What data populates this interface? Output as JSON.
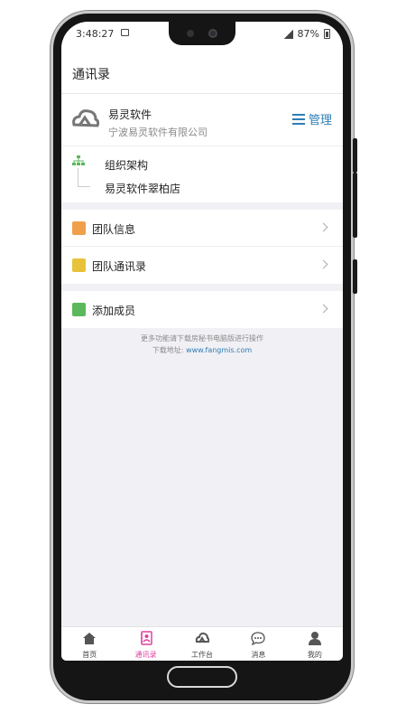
{
  "status_bar": {
    "time": "3:48:27",
    "battery": "87%"
  },
  "header": {
    "title": "通讯录"
  },
  "company": {
    "name": "易灵软件",
    "full_name": "宁波易灵软件有限公司",
    "manage_label": "管理"
  },
  "org": {
    "title": "组织架构",
    "store": "易灵软件翠柏店"
  },
  "menu": {
    "group1": [
      {
        "label": "团队信息",
        "icon": "team-info-icon",
        "color": "#f0a04b"
      },
      {
        "label": "团队通讯录",
        "icon": "team-contacts-icon",
        "color": "#e8c23a"
      }
    ],
    "group2": [
      {
        "label": "添加成员",
        "icon": "add-member-icon",
        "color": "#5cb85c"
      }
    ]
  },
  "hint": {
    "line1": "更多功能请下载房秘书电脑版进行操作",
    "line2_prefix": "下载地址: ",
    "url": "www.fangmis.com"
  },
  "tabbar": [
    {
      "label": "首页",
      "icon": "home-icon",
      "active": false
    },
    {
      "label": "通讯录",
      "icon": "contacts-icon",
      "active": true
    },
    {
      "label": "工作台",
      "icon": "workbench-icon",
      "active": false
    },
    {
      "label": "消息",
      "icon": "message-icon",
      "active": false
    },
    {
      "label": "我的",
      "icon": "profile-icon",
      "active": false
    }
  ],
  "colors": {
    "accent": "#2f7db3",
    "active_tab": "#e040a0"
  }
}
